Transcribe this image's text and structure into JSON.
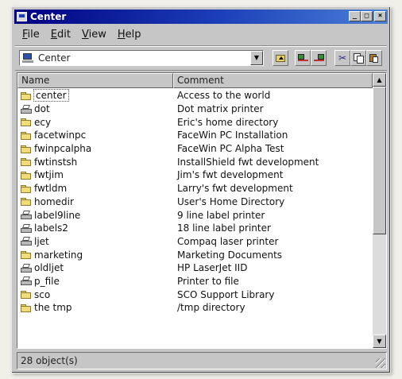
{
  "window": {
    "title": "Center"
  },
  "menu": [
    {
      "first": "F",
      "rest": "ile"
    },
    {
      "first": "E",
      "rest": "dit"
    },
    {
      "first": "V",
      "rest": "iew"
    },
    {
      "first": "H",
      "rest": "elp"
    }
  ],
  "toolbar": {
    "location": "Center",
    "dropdown_arrow": "▼"
  },
  "columns": {
    "name": "Name",
    "comment": "Comment"
  },
  "rows": [
    {
      "icon": "folder-icon",
      "name": "center",
      "comment": "Access to the world"
    },
    {
      "icon": "printer-icon",
      "name": "dot",
      "comment": "Dot matrix printer"
    },
    {
      "icon": "folder-icon",
      "name": "ecy",
      "comment": "Eric's home directory"
    },
    {
      "icon": "folder-icon",
      "name": "facetwinpc",
      "comment": "FaceWin PC Installation"
    },
    {
      "icon": "folder-icon",
      "name": "fwinpcalpha",
      "comment": "FaceWin PC Alpha Test"
    },
    {
      "icon": "folder-icon",
      "name": "fwtinstsh",
      "comment": "InstallShield fwt development"
    },
    {
      "icon": "folder-icon",
      "name": "fwtjim",
      "comment": "Jim's fwt development"
    },
    {
      "icon": "folder-icon",
      "name": "fwtldm",
      "comment": "Larry's fwt development"
    },
    {
      "icon": "folder-icon",
      "name": "homedir",
      "comment": "User's Home Directory"
    },
    {
      "icon": "printer-icon",
      "name": "label9line",
      "comment": "9 line label printer"
    },
    {
      "icon": "printer-icon",
      "name": "labels2",
      "comment": "18 line label printer"
    },
    {
      "icon": "printer-icon",
      "name": "ljet",
      "comment": "Compaq laser printer"
    },
    {
      "icon": "folder-icon",
      "name": "marketing",
      "comment": "Marketing Documents"
    },
    {
      "icon": "printer-icon",
      "name": "oldljet",
      "comment": "HP LaserJet IID"
    },
    {
      "icon": "printer-icon",
      "name": "p_file",
      "comment": "Printer to file"
    },
    {
      "icon": "folder-icon",
      "name": "sco",
      "comment": "SCO Support Library"
    },
    {
      "icon": "folder-icon",
      "name": "the tmp",
      "comment": "/tmp directory"
    }
  ],
  "status": {
    "text": "28 object(s)"
  },
  "colors": {
    "titlebar": "#000080",
    "face": "#c6c6c6"
  }
}
